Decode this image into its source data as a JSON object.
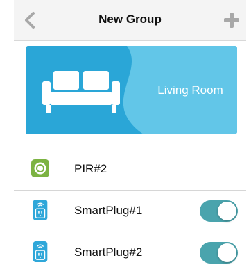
{
  "navbar": {
    "title": "New Group",
    "back_icon": "chevron-left-icon",
    "add_icon": "plus-icon"
  },
  "group_card": {
    "room_label": "Living Room",
    "room_icon": "sofa-icon",
    "colors": {
      "card_dark": "#2aa6d7",
      "card_light": "#62c6e8"
    }
  },
  "devices": [
    {
      "name": "PIR#2",
      "icon": "motion-sensor-icon",
      "has_toggle": false
    },
    {
      "name": "SmartPlug#1",
      "icon": "smart-plug-icon",
      "has_toggle": true,
      "toggle_on": true
    },
    {
      "name": "SmartPlug#2",
      "icon": "smart-plug-icon",
      "has_toggle": true,
      "toggle_on": true
    }
  ],
  "colors": {
    "toggle_on": "#4aa4ad",
    "pir_green": "#7cb342",
    "plug_blue": "#2fa7d9",
    "nav_icon_gray": "#a8a8a8"
  }
}
